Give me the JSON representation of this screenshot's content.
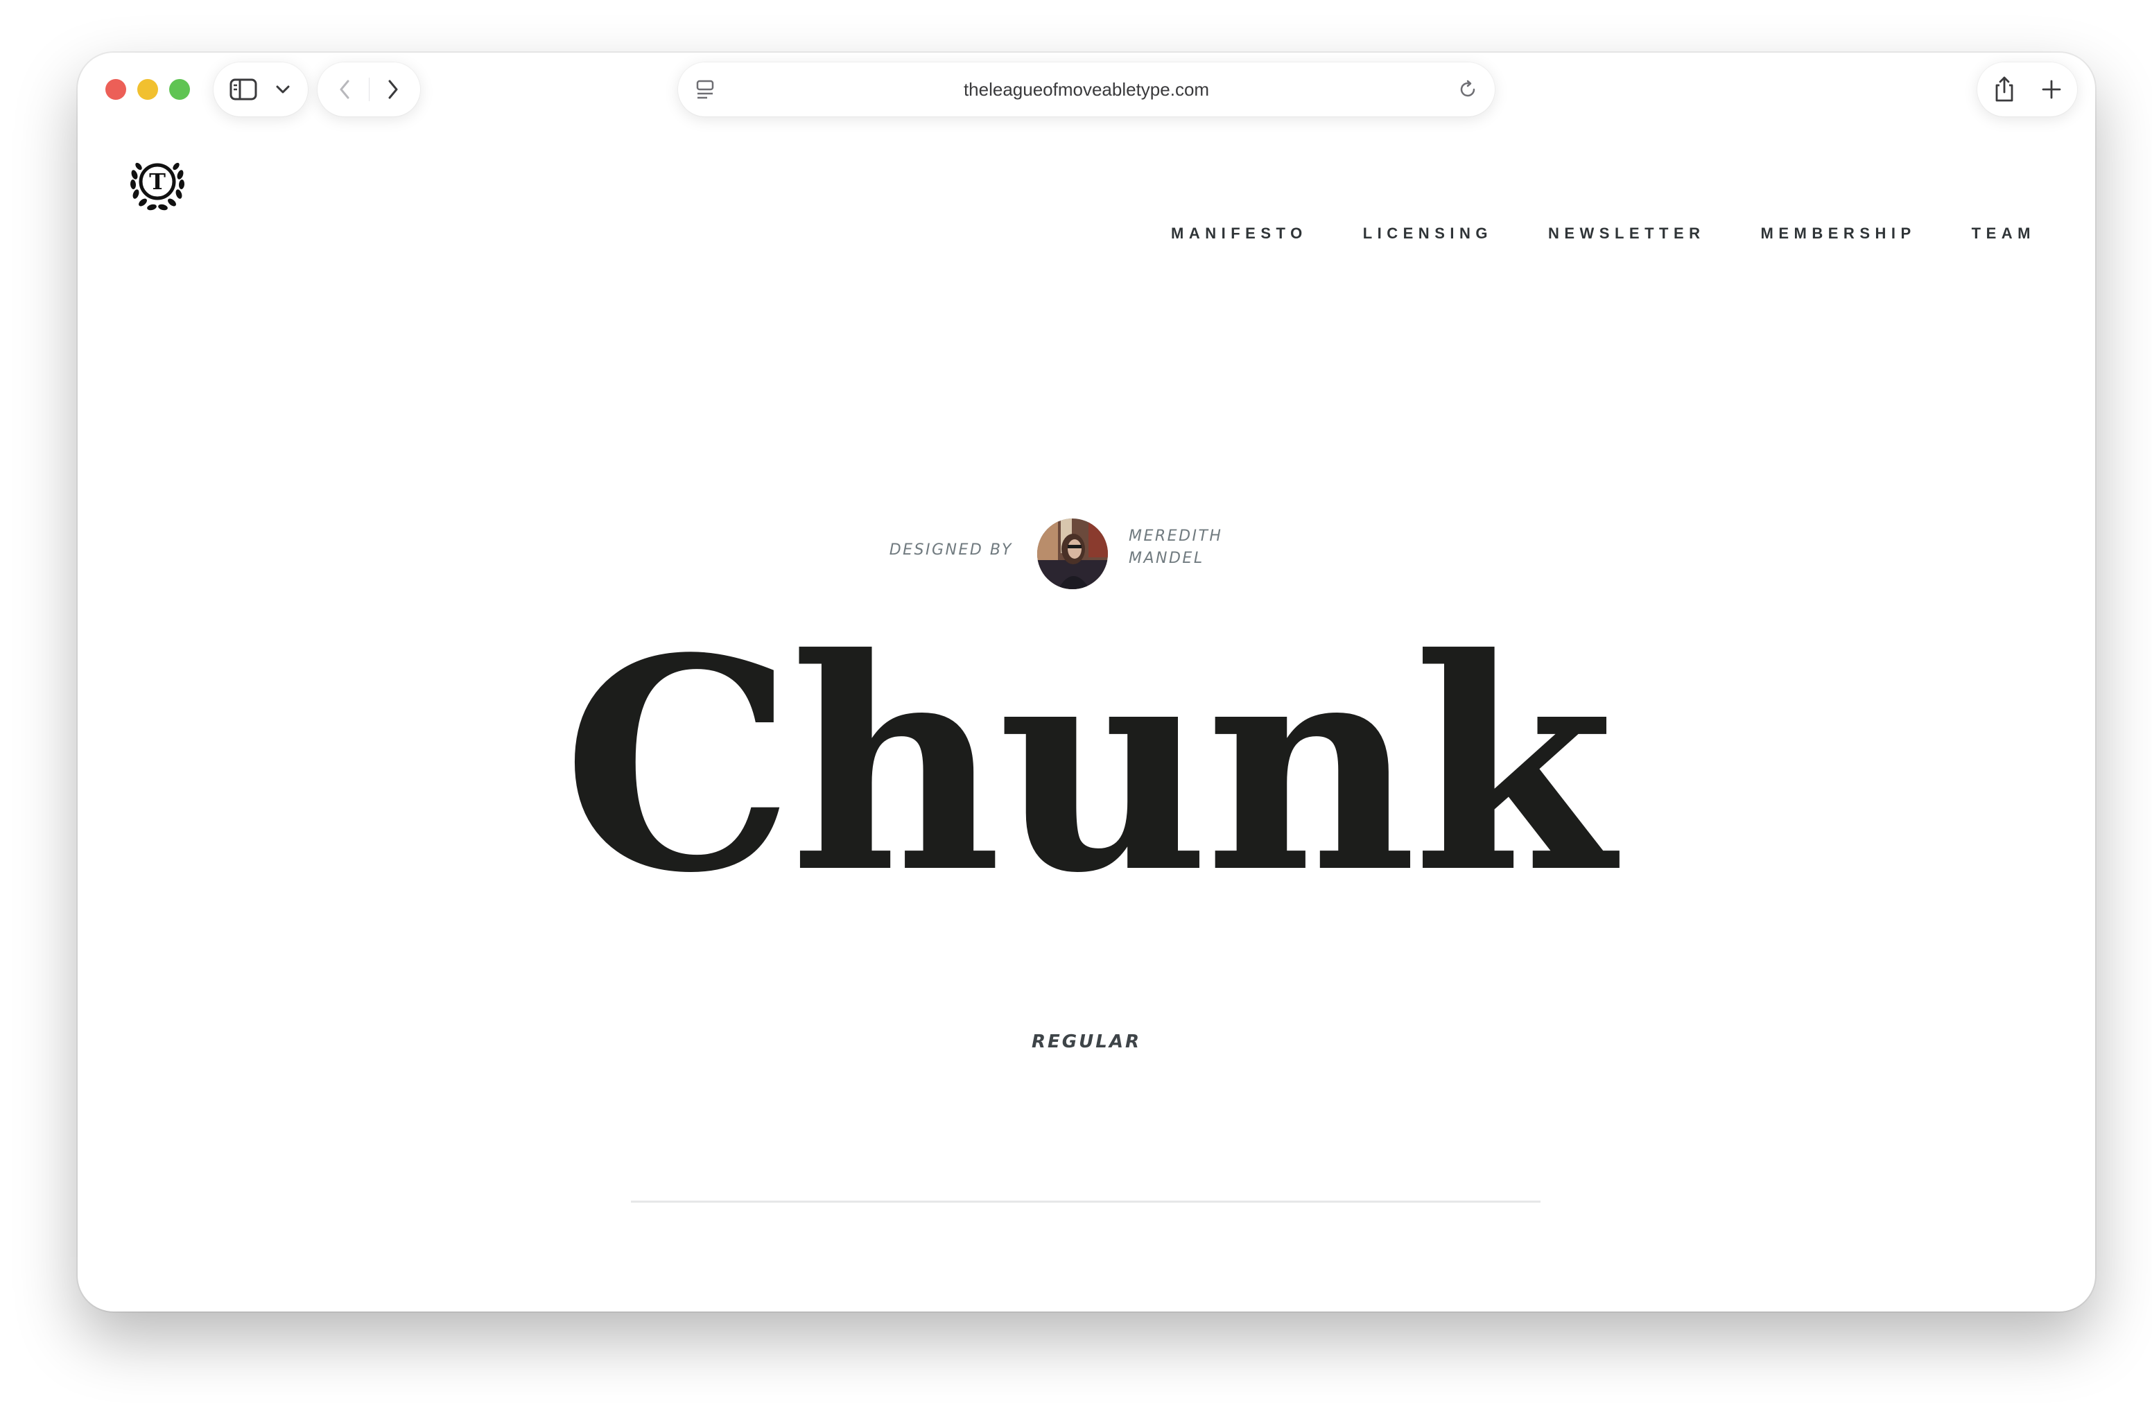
{
  "browser": {
    "url": "theleagueofmoveabletype.com",
    "icons": {
      "sidebar": "sidebar-icon",
      "dropdown": "chevron-down-icon",
      "back": "back-arrow-icon",
      "forward": "forward-arrow-icon",
      "page_menu": "page-menu-icon",
      "reload": "reload-icon",
      "share": "share-icon",
      "new_tab": "plus-icon"
    }
  },
  "site": {
    "logo": "league-laurel-logo",
    "nav": [
      {
        "label": "MANIFESTO"
      },
      {
        "label": "LICENSING"
      },
      {
        "label": "NEWSLETTER"
      },
      {
        "label": "MEMBERSHIP"
      },
      {
        "label": "TEAM"
      }
    ]
  },
  "font": {
    "designed_by_label": "Designed by",
    "designer_name_line1": "Meredith",
    "designer_name_line2": "Mandel",
    "name": "Chunk",
    "weight": "REGULAR"
  },
  "colors": {
    "text_dark": "#1c1d1b",
    "nav_text": "#2f3437",
    "muted": "#707a7f"
  }
}
